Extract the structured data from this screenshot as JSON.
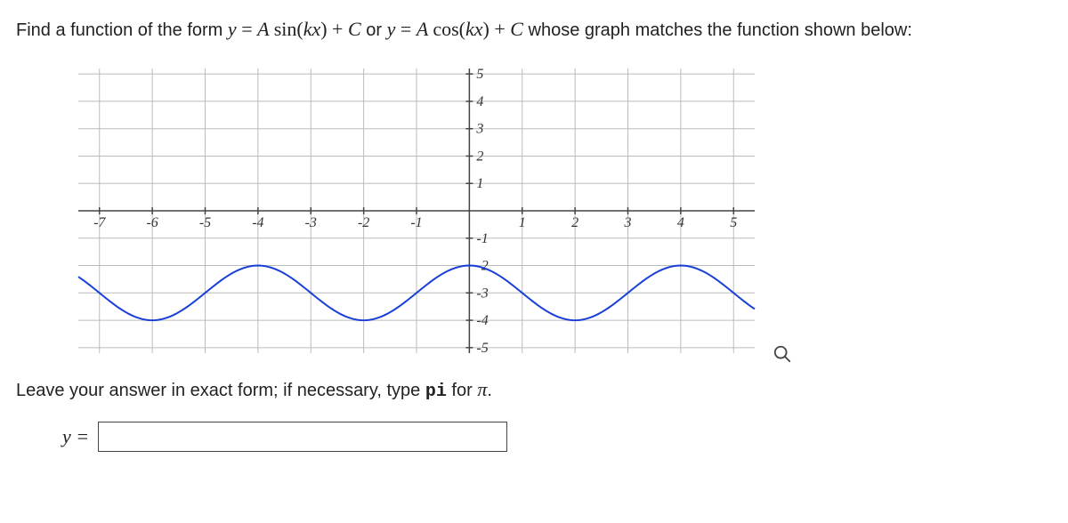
{
  "question": {
    "prefix": "Find a function of the form ",
    "form1_y": "y",
    "eq": "=",
    "form1_expr": "A sin(kx) + C",
    "or": " or ",
    "form2_y": "y",
    "form2_expr": "A cos(kx) + C",
    "suffix": " whose graph matches the function shown below:"
  },
  "hint": {
    "prefix": "Leave your answer in exact form; if necessary, type ",
    "pi_code": "pi",
    "mid": " for ",
    "pi_sym": "π",
    "suffix": "."
  },
  "answer": {
    "lhs": "y =",
    "value": "",
    "placeholder": ""
  },
  "chart_data": {
    "type": "line",
    "xlim": [
      -7.4,
      5.4
    ],
    "ylim": [
      -5.2,
      5.2
    ],
    "xticks": [
      -7,
      -6,
      -5,
      -4,
      -3,
      -2,
      -1,
      1,
      2,
      3,
      4,
      5
    ],
    "yticks": [
      -5,
      -4,
      -3,
      -2,
      -1,
      1,
      2,
      3,
      4,
      5
    ],
    "grid": true,
    "curve": {
      "A": 1,
      "k_over_pi": 0.5,
      "C": -3,
      "fn": "cos",
      "note": "y = cos(pi/2 * x) - 3; maxima (y=-2) at x=-4,0,4; minima (y=-4) at x=-6,-2,2"
    },
    "sample_points": [
      {
        "x": -7,
        "y": -3
      },
      {
        "x": -6,
        "y": -4
      },
      {
        "x": -5,
        "y": -3
      },
      {
        "x": -4,
        "y": -2
      },
      {
        "x": -3,
        "y": -3
      },
      {
        "x": -2,
        "y": -4
      },
      {
        "x": -1,
        "y": -3
      },
      {
        "x": 0,
        "y": -2
      },
      {
        "x": 1,
        "y": -3
      },
      {
        "x": 2,
        "y": -4
      },
      {
        "x": 3,
        "y": -3
      },
      {
        "x": 4,
        "y": -2
      },
      {
        "x": 5,
        "y": -3
      }
    ]
  }
}
